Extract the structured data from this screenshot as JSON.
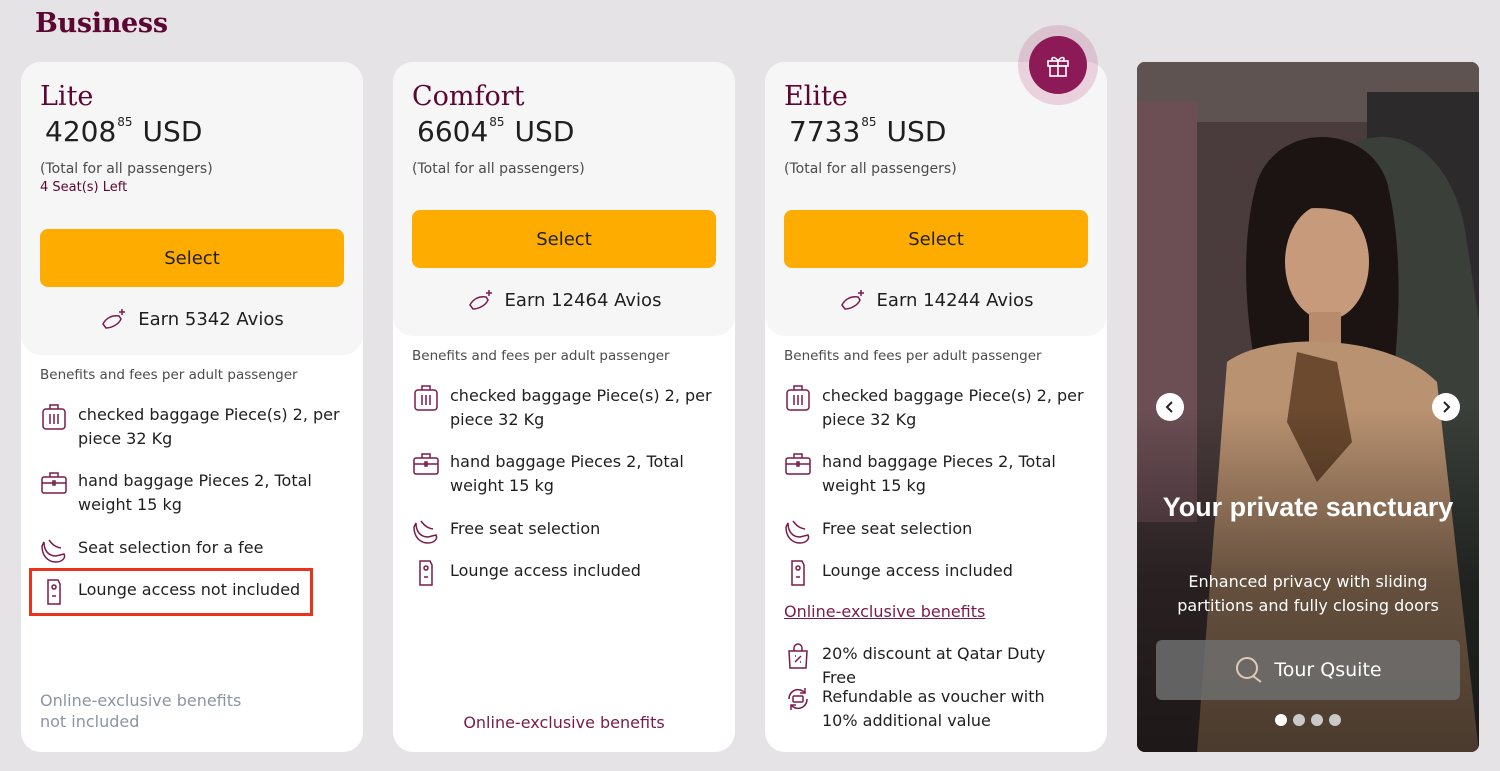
{
  "page": {
    "title": "Business"
  },
  "fares": [
    {
      "name": "Lite",
      "price_main": "4208",
      "price_cents": "85",
      "currency": "USD",
      "total_note": "(Total for all passengers)",
      "seats_left": "4 Seat(s) Left",
      "select_label": "Select",
      "avios": "Earn 5342 Avios",
      "benefits_title": "Benefits and fees per adult passenger",
      "benefits": [
        {
          "icon": "checked-baggage-icon",
          "text": "checked baggage Piece(s) 2, per piece 32 Kg"
        },
        {
          "icon": "hand-baggage-icon",
          "text": "hand baggage Pieces 2, Total weight 15 kg"
        },
        {
          "icon": "seat-icon",
          "text": "Seat selection for a fee"
        },
        {
          "icon": "lounge-icon",
          "text": "Lounge access not included"
        }
      ],
      "online_exclusive": "Online-exclusive benefits not included"
    },
    {
      "name": "Comfort",
      "price_main": "6604",
      "price_cents": "85",
      "currency": "USD",
      "total_note": "(Total for all passengers)",
      "select_label": "Select",
      "avios": "Earn 12464 Avios",
      "benefits_title": "Benefits and fees per adult passenger",
      "benefits": [
        {
          "icon": "checked-baggage-icon",
          "text": "checked baggage Piece(s) 2, per piece 32 Kg"
        },
        {
          "icon": "hand-baggage-icon",
          "text": "hand baggage Pieces 2, Total weight 15 kg"
        },
        {
          "icon": "seat-icon",
          "text": "Free seat selection"
        },
        {
          "icon": "lounge-icon",
          "text": "Lounge access included"
        }
      ],
      "online_exclusive": "Online-exclusive benefits"
    },
    {
      "name": "Elite",
      "price_main": "7733",
      "price_cents": "85",
      "currency": "USD",
      "total_note": "(Total for all passengers)",
      "select_label": "Select",
      "avios": "Earn 14244 Avios",
      "benefits_title": "Benefits and fees per adult passenger",
      "benefits": [
        {
          "icon": "checked-baggage-icon",
          "text": "checked baggage Piece(s) 2, per piece 32 Kg"
        },
        {
          "icon": "hand-baggage-icon",
          "text": "hand baggage Pieces 2, Total weight 15 kg"
        },
        {
          "icon": "seat-icon",
          "text": "Free seat selection"
        },
        {
          "icon": "lounge-icon",
          "text": "Lounge access included"
        }
      ],
      "online_exclusive": "Online-exclusive benefits",
      "exclusive_benefits": [
        {
          "icon": "shopping-bag-icon",
          "text": "20% discount at Qatar Duty Free"
        },
        {
          "icon": "refund-voucher-icon",
          "text": "Refundable as voucher with 10% additional value"
        }
      ]
    }
  ],
  "promo": {
    "title": "Your private sanctuary",
    "subtitle": "Enhanced privacy with sliding partitions and fully closing doors",
    "tour_label": "Tour Qsuite",
    "slide_count": 4,
    "active_slide": 1
  },
  "colors": {
    "brand": "#5c0632",
    "accent": "#ffac00",
    "highlight": "#e8341c"
  }
}
